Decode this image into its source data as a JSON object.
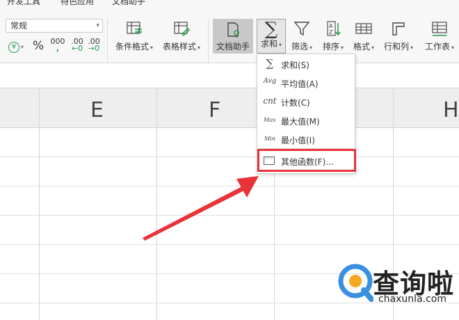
{
  "menubar": {
    "items": [
      "开发工具",
      "特色应用",
      "文档助手"
    ]
  },
  "ribbon": {
    "number_format": {
      "selected": "常规",
      "buttons": [
        "currency-icon",
        "percent-style",
        "thousands-separator",
        "increase-decimal",
        "decrease-decimal"
      ],
      "currency_symbol": "¥",
      "percent_label": "%",
      "comma_label_top": "000",
      "comma_label_bottom": ",",
      "inc_top": "←0",
      "inc_bottom": ".00",
      "dec_top": ".00",
      "dec_bottom": "→0"
    },
    "cond_format_label": "条件格式",
    "table_style_label": "表格样式",
    "doc_assistant_label": "文档助手",
    "sum_label": "求和",
    "filter_label": "筛选",
    "sort_label": "排序",
    "format_label": "格式",
    "rowcol_label": "行和列",
    "worksheet_label": "工作表",
    "chevron": "▾"
  },
  "grid": {
    "columns": [
      "E",
      "F",
      "H"
    ]
  },
  "dropdown": {
    "items": [
      {
        "icon_text": "∑",
        "label": "求和(S)"
      },
      {
        "icon_text": "Avg",
        "label": "平均值(A)"
      },
      {
        "icon_text": "cnt",
        "label": "计数(C)"
      },
      {
        "icon_text": "Max",
        "label": "最大值(M)"
      },
      {
        "icon_text": "Min",
        "label": "最小值(I)"
      },
      {
        "icon_text": "",
        "label": "其他函数(F)..."
      }
    ]
  },
  "annotation": {
    "arrow_color": "#e8333a",
    "box_color": "#e8333a"
  },
  "watermark": {
    "text": "查询啦",
    "domain": "chaxunla.com",
    "brand_color": "#3a8fe0"
  }
}
